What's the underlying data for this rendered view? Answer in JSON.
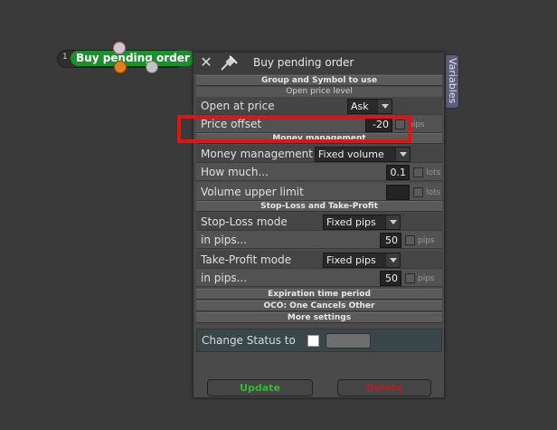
{
  "node": {
    "index": "1",
    "label": "Buy pending order"
  },
  "panel": {
    "title": "Buy pending order",
    "variables_tab": "Variables",
    "section_group_symbol": "Group and Symbol to use",
    "subsection_open_price": "Open price level",
    "open_at_price": {
      "label": "Open at price",
      "value": "Ask"
    },
    "price_offset": {
      "label": "Price offset",
      "value": "-20",
      "unit": "pips"
    },
    "section_money": "Money management",
    "money_management": {
      "label": "Money management",
      "value": "Fixed volume"
    },
    "how_much": {
      "label": "How much...",
      "value": "0.1",
      "unit": "lots"
    },
    "volume_upper": {
      "label": "Volume upper limit",
      "value": "",
      "unit": "lots"
    },
    "section_sl_tp": "Stop-Loss and Take-Profit",
    "sl_mode": {
      "label": "Stop-Loss mode",
      "value": "Fixed pips"
    },
    "sl_pips": {
      "label": "in pips...",
      "value": "50",
      "unit": "pips"
    },
    "tp_mode": {
      "label": "Take-Profit mode",
      "value": "Fixed pips"
    },
    "tp_pips": {
      "label": "in pips...",
      "value": "50",
      "unit": "pips"
    },
    "section_expiration": "Expiration time period",
    "section_oco": "OCO: One Cancels Other",
    "section_more": "More settings",
    "change_status": {
      "label": "Change Status to"
    },
    "update_button": "Update",
    "delete_button": "Delete"
  },
  "colors": {
    "update": "#34b935",
    "delete": "#b22222",
    "node": "#1f8e2e",
    "highlight": "#e01414"
  }
}
